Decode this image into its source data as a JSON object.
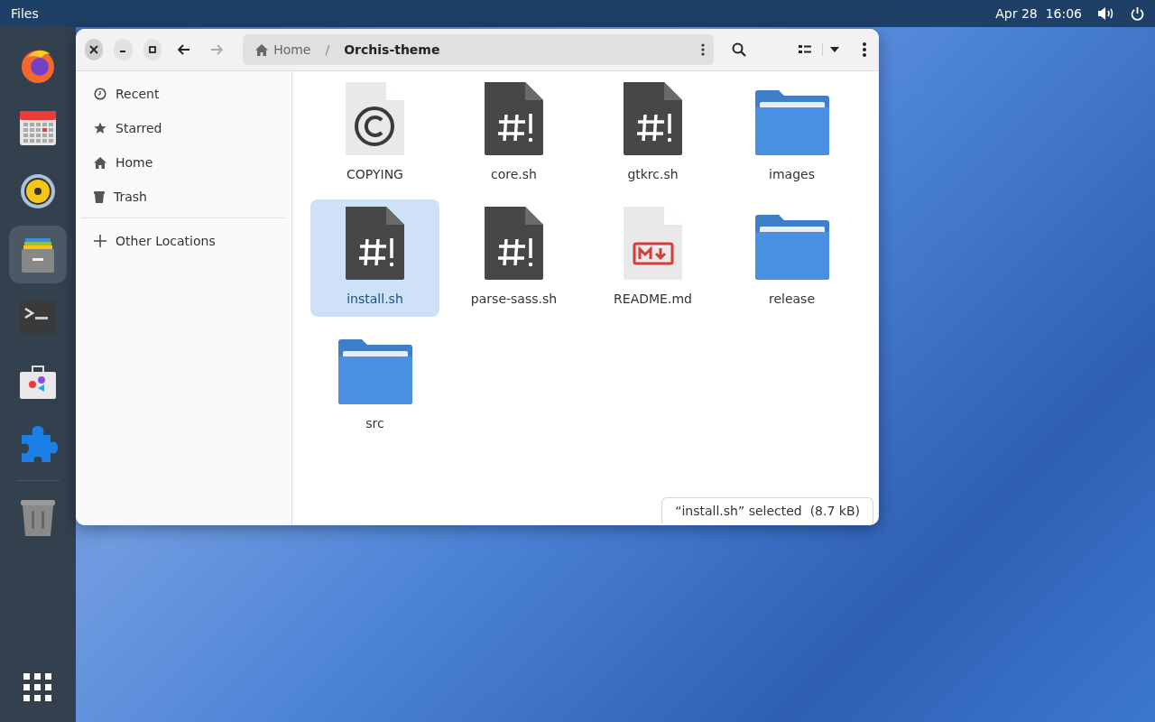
{
  "top_bar": {
    "app_menu": "Files",
    "clock": "Apr 28  16:06"
  },
  "dock": {
    "items": [
      {
        "kind": "browser",
        "active": false
      },
      {
        "kind": "calendar",
        "active": false
      },
      {
        "kind": "speaker",
        "active": false
      },
      {
        "kind": "files",
        "active": true
      },
      {
        "kind": "terminal",
        "active": false
      },
      {
        "kind": "store",
        "active": false
      },
      {
        "kind": "extensions",
        "active": false
      },
      {
        "kind": "trash",
        "active": false
      }
    ]
  },
  "window": {
    "path_separator": "/",
    "path": [
      {
        "label": "Home",
        "kind": "home"
      },
      {
        "label": "Orchis-theme",
        "kind": "current"
      }
    ],
    "sidebar": {
      "items": [
        {
          "label": "Recent",
          "kind": "recent",
          "selected": false
        },
        {
          "label": "Starred",
          "kind": "starred",
          "selected": false
        },
        {
          "label": "Home",
          "kind": "home",
          "selected": false
        },
        {
          "label": "Trash",
          "kind": "trash",
          "selected": false
        }
      ],
      "other": {
        "label": "Other Locations",
        "kind": "add"
      }
    },
    "files": [
      {
        "name": "COPYING",
        "kind": "license",
        "selected": false
      },
      {
        "name": "core.sh",
        "kind": "script",
        "selected": false
      },
      {
        "name": "gtkrc.sh",
        "kind": "script",
        "selected": false
      },
      {
        "name": "images",
        "kind": "folder",
        "selected": false
      },
      {
        "name": "install.sh",
        "kind": "script",
        "selected": true
      },
      {
        "name": "parse-sass.sh",
        "kind": "script",
        "selected": false
      },
      {
        "name": "README.md",
        "kind": "markdown",
        "selected": false
      },
      {
        "name": "release",
        "kind": "folder",
        "selected": false
      },
      {
        "name": "src",
        "kind": "folder",
        "selected": false
      }
    ],
    "status": "“install.sh” selected  (8.7 kB)"
  }
}
